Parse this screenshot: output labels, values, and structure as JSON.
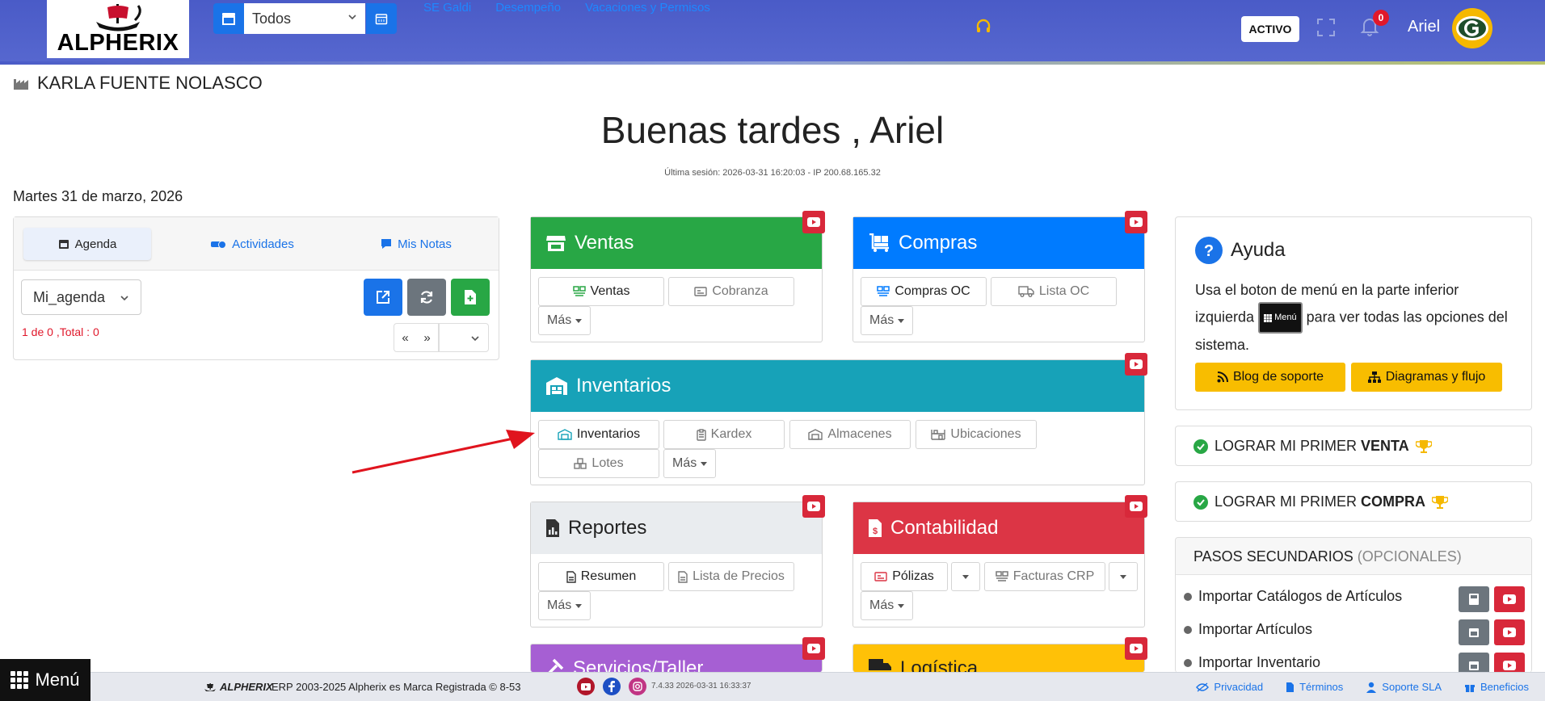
{
  "topbar": {
    "logo_text": "ALPHERIX",
    "branch_select": "Todos",
    "links": [
      "SE Galdi",
      "Desempeño",
      "Vacaciones y Permisos"
    ],
    "status_badge": "ACTIVO",
    "notification_count": "0",
    "user_name": "Ariel"
  },
  "header": {
    "company": "KARLA FUENTE NOLASCO",
    "greeting": "Buenas tardes , Ariel",
    "session": "Última sesión: 2026-03-31 16:20:03 - IP 200.68.165.32",
    "date": "Martes 31 de marzo, 2026"
  },
  "agenda": {
    "tabs": [
      "Agenda",
      "Actividades",
      "Mis Notas"
    ],
    "select_value": "Mi_agenda",
    "pager_text": "1 de 0 ,Total : 0",
    "pager_prev": "«",
    "pager_next": "»"
  },
  "modules": {
    "ventas": {
      "title": "Ventas",
      "buttons": [
        "Ventas",
        "Cobranza"
      ],
      "more": "Más"
    },
    "compras": {
      "title": "Compras",
      "buttons": [
        "Compras OC",
        "Lista OC"
      ],
      "more": "Más"
    },
    "inventarios": {
      "title": "Inventarios",
      "buttons": [
        "Inventarios",
        "Kardex",
        "Almacenes",
        "Ubicaciones",
        "Lotes"
      ],
      "more": "Más"
    },
    "reportes": {
      "title": "Reportes",
      "buttons": [
        "Resumen",
        "Lista de Precios"
      ],
      "more": "Más"
    },
    "contabilidad": {
      "title": "Contabilidad",
      "buttons": [
        "Pólizas",
        "Facturas CRP"
      ],
      "more": "Más"
    },
    "servicios": {
      "title": "Servicios/Taller"
    },
    "logistica": {
      "title": "Logística"
    }
  },
  "colors": {
    "ventas": "#28a745",
    "compras": "#007bff",
    "inventarios": "#17a2b8",
    "reportes": "#e9ecef",
    "contabilidad": "#dc3545",
    "servicios": "#a65fd3",
    "logistica": "#ffc107"
  },
  "help": {
    "title": "Ayuda",
    "text_before": "Usa el boton de menú en la parte inferior izquierda",
    "chip": "Menú",
    "text_after": "para ver todas las opciones del sistema.",
    "blog_button": "Blog de soporte",
    "diagram_button": "Diagramas y flujo"
  },
  "goals": {
    "first_sale_prefix": "LOGRAR MI PRIMER",
    "first_sale_bold": "VENTA",
    "first_purchase_prefix": "LOGRAR MI PRIMER",
    "first_purchase_bold": "COMPRA"
  },
  "steps": {
    "title": "PASOS SECUNDARIOS",
    "subtitle": "(OPCIONALES)",
    "items": [
      "Importar Catálogos de Artículos",
      "Importar Artículos",
      "Importar Inventario"
    ]
  },
  "footer": {
    "menu_label": "Menú",
    "brand": "ALPHERIX",
    "copyright": "ERP 2003-2025 Alpherix es Marca Registrada © 8-53",
    "version": "7.4.33  2026-03-31 16:33:37",
    "links": [
      "Privacidad",
      "Términos",
      "Soporte SLA",
      "Beneficios"
    ]
  }
}
